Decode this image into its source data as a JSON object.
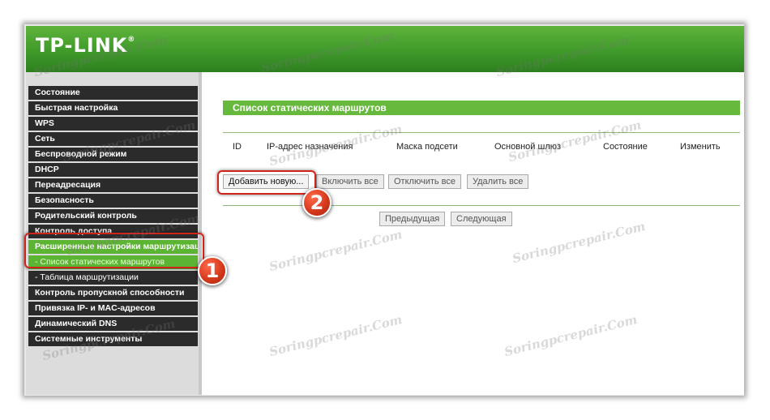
{
  "brand": {
    "logo": "TP-LINK",
    "logo_mark": "®"
  },
  "sidebar": {
    "items": [
      {
        "label": "Состояние"
      },
      {
        "label": "Быстрая настройка"
      },
      {
        "label": "WPS"
      },
      {
        "label": "Сеть"
      },
      {
        "label": "Беспроводной режим"
      },
      {
        "label": "DHCP"
      },
      {
        "label": "Переадресация"
      },
      {
        "label": "Безопасность"
      },
      {
        "label": "Родительский контроль"
      },
      {
        "label": "Контроль доступа"
      },
      {
        "label": "Расширенные настройки маршрутизации",
        "state": "active-parent"
      },
      {
        "label": "- Список статических маршрутов",
        "state": "active-child"
      },
      {
        "label": "- Таблица маршрутизации",
        "state": "sub"
      },
      {
        "label": "Контроль пропускной способности"
      },
      {
        "label": "Привязка IP- и MAC-адресов"
      },
      {
        "label": "Динамический DNS"
      },
      {
        "label": "Системные инструменты"
      }
    ]
  },
  "main": {
    "title": "Список статических маршрутов",
    "columns": {
      "id": "ID",
      "dest": "IP-адрес назначения",
      "mask": "Маска подсети",
      "gateway": "Основной шлюз",
      "status": "Состояние",
      "modify": "Изменить"
    },
    "buttons": {
      "add_new": "Добавить новую...",
      "enable_all": "Включить все",
      "disable_all": "Отключить все",
      "delete_all": "Удалить все",
      "prev": "Предыдущая",
      "next": "Следующая"
    }
  },
  "annotations": {
    "step1": "1",
    "step2": "2"
  },
  "watermark": {
    "text": "Soringpcrepair.Com"
  },
  "colors": {
    "brand_green": "#5cb433",
    "header_green": "#3f9a2a",
    "menu_dark": "#2b2b2b",
    "callout_red": "#d0241b"
  }
}
